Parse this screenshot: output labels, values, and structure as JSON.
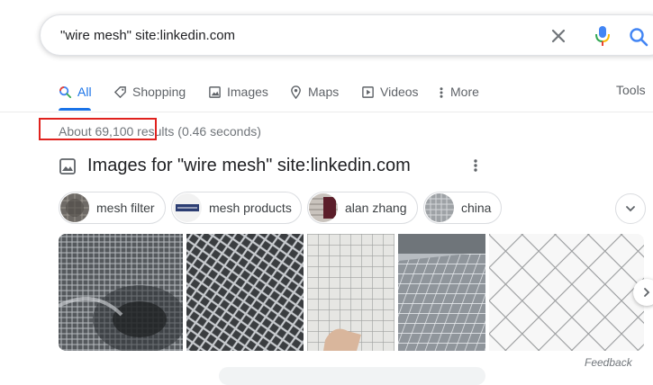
{
  "search": {
    "query": "\"wire mesh\" site:linkedin.com"
  },
  "tabs": [
    {
      "label": "All",
      "icon": "search-icon",
      "active": true
    },
    {
      "label": "Shopping",
      "icon": "tag-icon"
    },
    {
      "label": "Images",
      "icon": "image-icon"
    },
    {
      "label": "Maps",
      "icon": "map-pin-icon"
    },
    {
      "label": "Videos",
      "icon": "play-icon"
    },
    {
      "label": "More",
      "icon": "more-vert-icon"
    }
  ],
  "tools_label": "Tools",
  "result_stats": "About 69,100 results (0.46 seconds)",
  "images_section": {
    "title": "Images for \"wire mesh\" site:linkedin.com",
    "chips": [
      {
        "label": "mesh filter"
      },
      {
        "label": "mesh products"
      },
      {
        "label": "alan zhang"
      },
      {
        "label": "china"
      }
    ]
  },
  "feedback_label": "Feedback",
  "colors": {
    "accent": "#1a73e8",
    "highlight": "#e0221e"
  }
}
